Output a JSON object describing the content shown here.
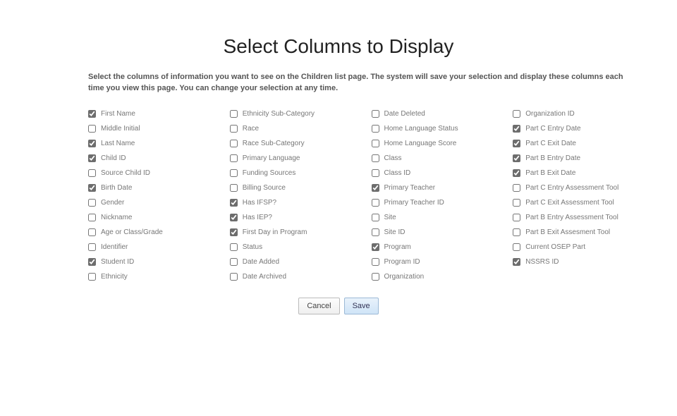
{
  "title": "Select Columns to Display",
  "instructions": "Select the columns of information you want to see on the Children list page. The system will save your selection and display these columns each time you view this page. You can change your selection at any time.",
  "columns": [
    [
      {
        "label": "First Name",
        "checked": true
      },
      {
        "label": "Middle Initial",
        "checked": false
      },
      {
        "label": "Last Name",
        "checked": true
      },
      {
        "label": "Child ID",
        "checked": true
      },
      {
        "label": "Source Child ID",
        "checked": false
      },
      {
        "label": "Birth Date",
        "checked": true
      },
      {
        "label": "Gender",
        "checked": false
      },
      {
        "label": "Nickname",
        "checked": false
      },
      {
        "label": "Age or Class/Grade",
        "checked": false
      },
      {
        "label": "Identifier",
        "checked": false
      },
      {
        "label": "Student ID",
        "checked": true
      },
      {
        "label": "Ethnicity",
        "checked": false
      }
    ],
    [
      {
        "label": "Ethnicity Sub-Category",
        "checked": false
      },
      {
        "label": "Race",
        "checked": false
      },
      {
        "label": "Race Sub-Category",
        "checked": false
      },
      {
        "label": "Primary Language",
        "checked": false
      },
      {
        "label": "Funding Sources",
        "checked": false
      },
      {
        "label": "Billing Source",
        "checked": false
      },
      {
        "label": "Has IFSP?",
        "checked": true
      },
      {
        "label": "Has IEP?",
        "checked": true
      },
      {
        "label": "First Day in Program",
        "checked": true
      },
      {
        "label": "Status",
        "checked": false
      },
      {
        "label": "Date Added",
        "checked": false
      },
      {
        "label": "Date Archived",
        "checked": false
      }
    ],
    [
      {
        "label": "Date Deleted",
        "checked": false
      },
      {
        "label": "Home Language Status",
        "checked": false
      },
      {
        "label": "Home Language Score",
        "checked": false
      },
      {
        "label": "Class",
        "checked": false
      },
      {
        "label": "Class ID",
        "checked": false
      },
      {
        "label": "Primary Teacher",
        "checked": true
      },
      {
        "label": "Primary Teacher ID",
        "checked": false
      },
      {
        "label": "Site",
        "checked": false
      },
      {
        "label": "Site ID",
        "checked": false
      },
      {
        "label": "Program",
        "checked": true
      },
      {
        "label": "Program ID",
        "checked": false
      },
      {
        "label": "Organization",
        "checked": false
      }
    ],
    [
      {
        "label": "Organization ID",
        "checked": false
      },
      {
        "label": "Part C Entry Date",
        "checked": true
      },
      {
        "label": "Part C Exit Date",
        "checked": true
      },
      {
        "label": "Part B Entry Date",
        "checked": true
      },
      {
        "label": "Part B Exit Date",
        "checked": true
      },
      {
        "label": "Part C Entry Assessment Tool",
        "checked": false
      },
      {
        "label": "Part C Exit Assessment Tool",
        "checked": false
      },
      {
        "label": "Part B Entry Assessment Tool",
        "checked": false
      },
      {
        "label": "Part B Exit Assesment Tool",
        "checked": false
      },
      {
        "label": "Current OSEP Part",
        "checked": false
      },
      {
        "label": "NSSRS ID",
        "checked": true
      }
    ]
  ],
  "buttons": {
    "cancel": "Cancel",
    "save": "Save"
  }
}
